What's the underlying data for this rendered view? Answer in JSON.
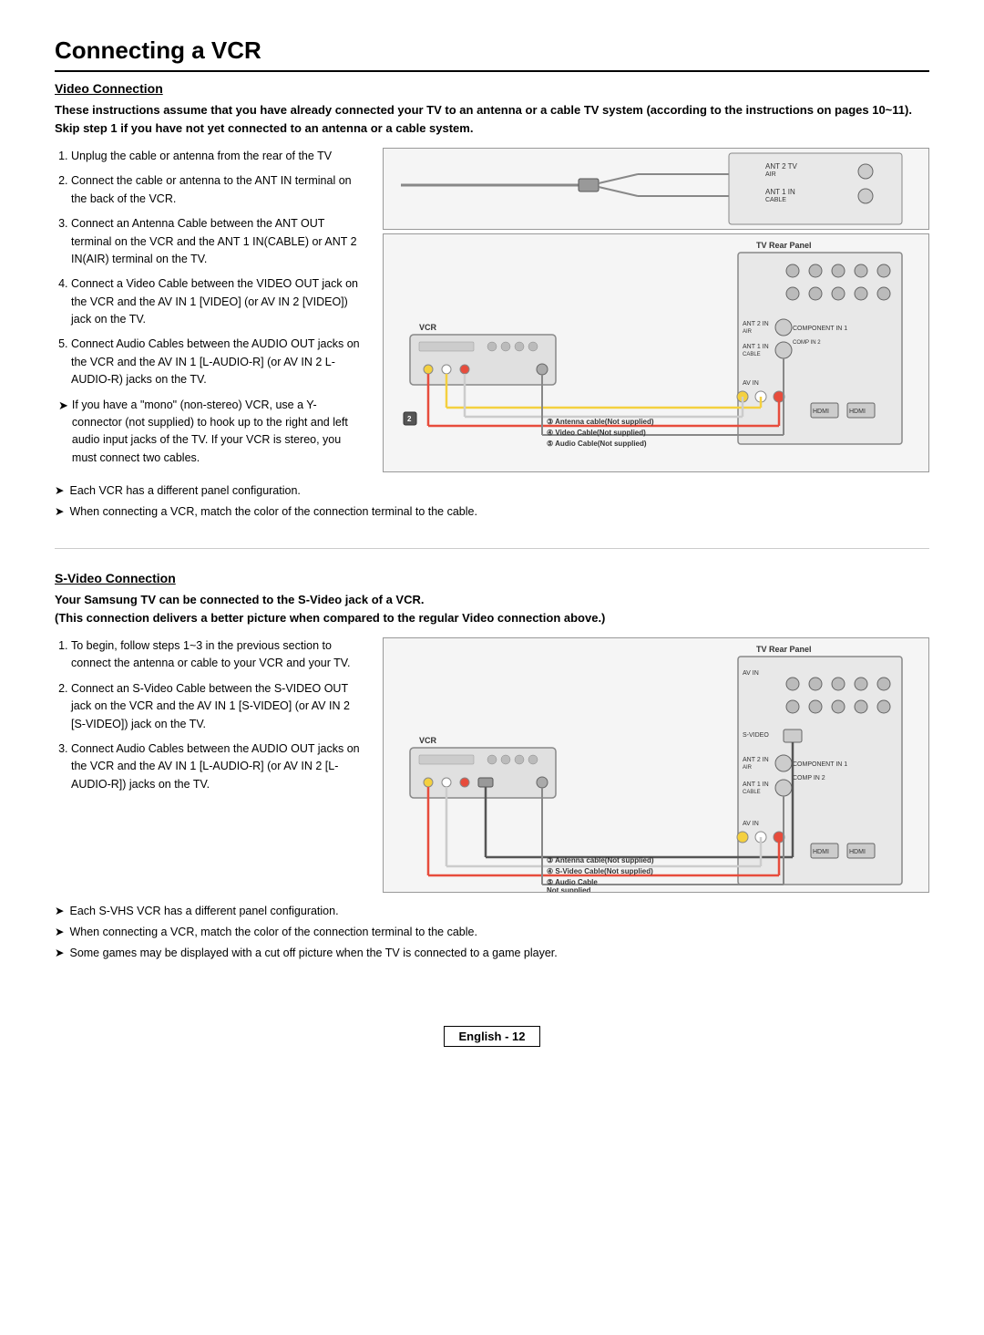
{
  "page": {
    "title": "Connecting a VCR",
    "footer_text": "English - 12"
  },
  "video_section": {
    "title": "Video Connection",
    "intro": "These instructions assume that you have already connected your TV to an antenna or a cable TV system (according to the instructions on pages 10~11). Skip step 1 if you have not yet connected to an antenna or a cable system.",
    "steps": [
      "Unplug the cable or antenna from the rear of the TV",
      "Connect the cable or antenna to the ANT IN terminal on the back of the VCR.",
      "Connect an Antenna Cable between the ANT OUT terminal on the VCR and the ANT 1 IN(CABLE) or ANT 2 IN(AIR) terminal on the TV.",
      "Connect a Video Cable between the VIDEO OUT jack on the VCR and the AV IN 1 [VIDEO] (or AV IN 2 [VIDEO]) jack on the TV.",
      "Connect Audio Cables between the AUDIO OUT jacks on the VCR and the AV IN 1 [L-AUDIO-R] (or AV IN 2 L-AUDIO-R) jacks on the TV."
    ],
    "arrow_notes": [
      "If you have a \"mono\" (non-stereo) VCR, use a Y-connector (not supplied) to hook up to the right and left audio input jacks of the TV. If your VCR is stereo, you must connect two cables."
    ],
    "diagram_labels": {
      "vcr": "VCR",
      "tv_rear": "TV Rear Panel",
      "cable3": "③ Antenna cable(Not supplied)",
      "cable4": "④ Video Cable(Not supplied)",
      "cable5": "⑤ Audio Cable(Not supplied)"
    },
    "bottom_notes": [
      "Each VCR has a different panel configuration.",
      "When connecting a VCR, match the color of the connection terminal to the cable."
    ]
  },
  "svideo_section": {
    "title": "S-Video Connection",
    "intro_bold": "Your Samsung TV can be connected to the S-Video jack of a VCR.",
    "intro_bold2": "(This connection delivers a better picture when compared to the regular Video connection above.)",
    "steps": [
      "To begin, follow steps 1~3 in the previous section to connect the antenna or cable to your VCR and your TV.",
      "Connect an S-Video Cable between the S-VIDEO OUT jack on the VCR and the AV IN 1 [S-VIDEO] (or AV IN 2 [S-VIDEO]) jack on the TV.",
      "Connect Audio Cables between the AUDIO OUT jacks on the VCR and the AV IN 1 [L-AUDIO-R] (or AV IN 2 [L-AUDIO-R]) jacks on the TV."
    ],
    "diagram_labels": {
      "vcr": "VCR",
      "tv_rear": "TV Rear Panel",
      "cable3": "③ Antenna cable(Not supplied)",
      "cable4": "④ S-Video Cable(Not supplied)",
      "cable5": "⑤ Audio Cable\n Not supplied"
    },
    "bottom_notes": [
      "Each S-VHS VCR has a different panel configuration.",
      "When connecting a VCR, match the color of the connection terminal to the cable.",
      "Some games may be displayed with a cut off picture when the TV is connected to a game player."
    ]
  }
}
